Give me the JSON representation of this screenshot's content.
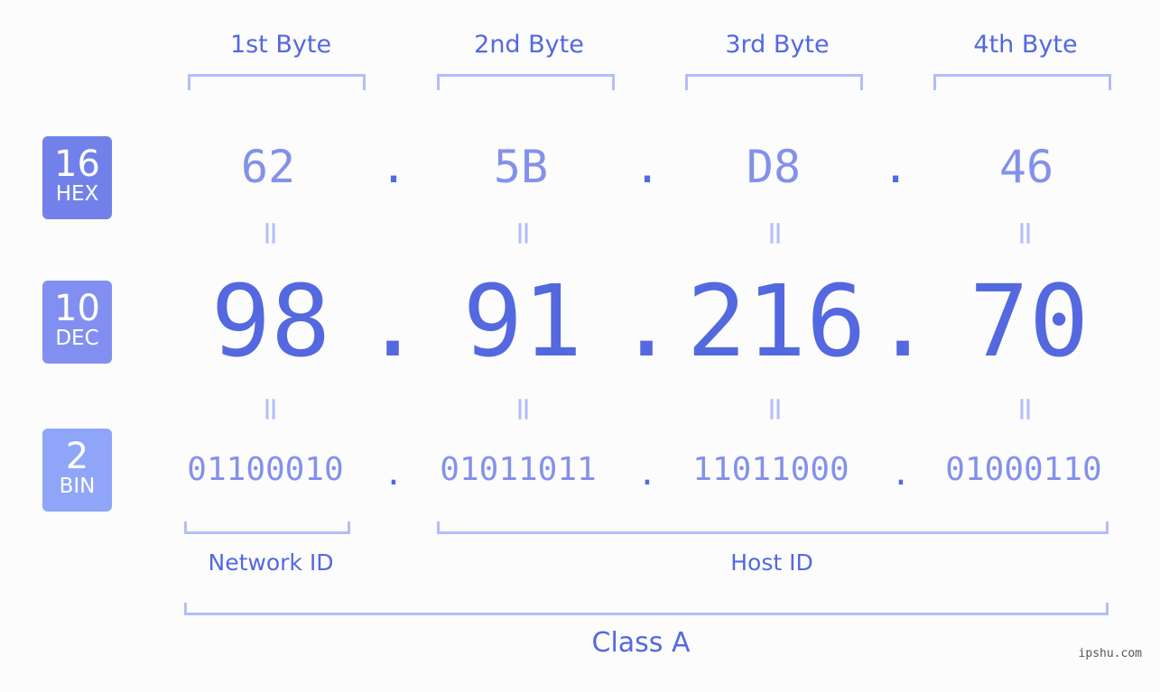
{
  "bytes": [
    {
      "label": "1st Byte",
      "hex": "62",
      "dec": "98",
      "bin": "01100010"
    },
    {
      "label": "2nd Byte",
      "hex": "5B",
      "dec": "91",
      "bin": "01011011"
    },
    {
      "label": "3rd Byte",
      "hex": "D8",
      "dec": "216",
      "bin": "11011000"
    },
    {
      "label": "4th Byte",
      "hex": "46",
      "dec": "70",
      "bin": "01000110"
    }
  ],
  "badges": {
    "hex": {
      "num": "16",
      "label": "HEX",
      "color": "#7281ea"
    },
    "dec": {
      "num": "10",
      "label": "DEC",
      "color": "#8190f0"
    },
    "bin": {
      "num": "2",
      "label": "BIN",
      "color": "#8fa5f7"
    }
  },
  "separator": ".",
  "equals": "=",
  "network_id_label": "Network ID",
  "host_id_label": "Host ID",
  "class_label": "Class A",
  "watermark": "ipshu.com"
}
